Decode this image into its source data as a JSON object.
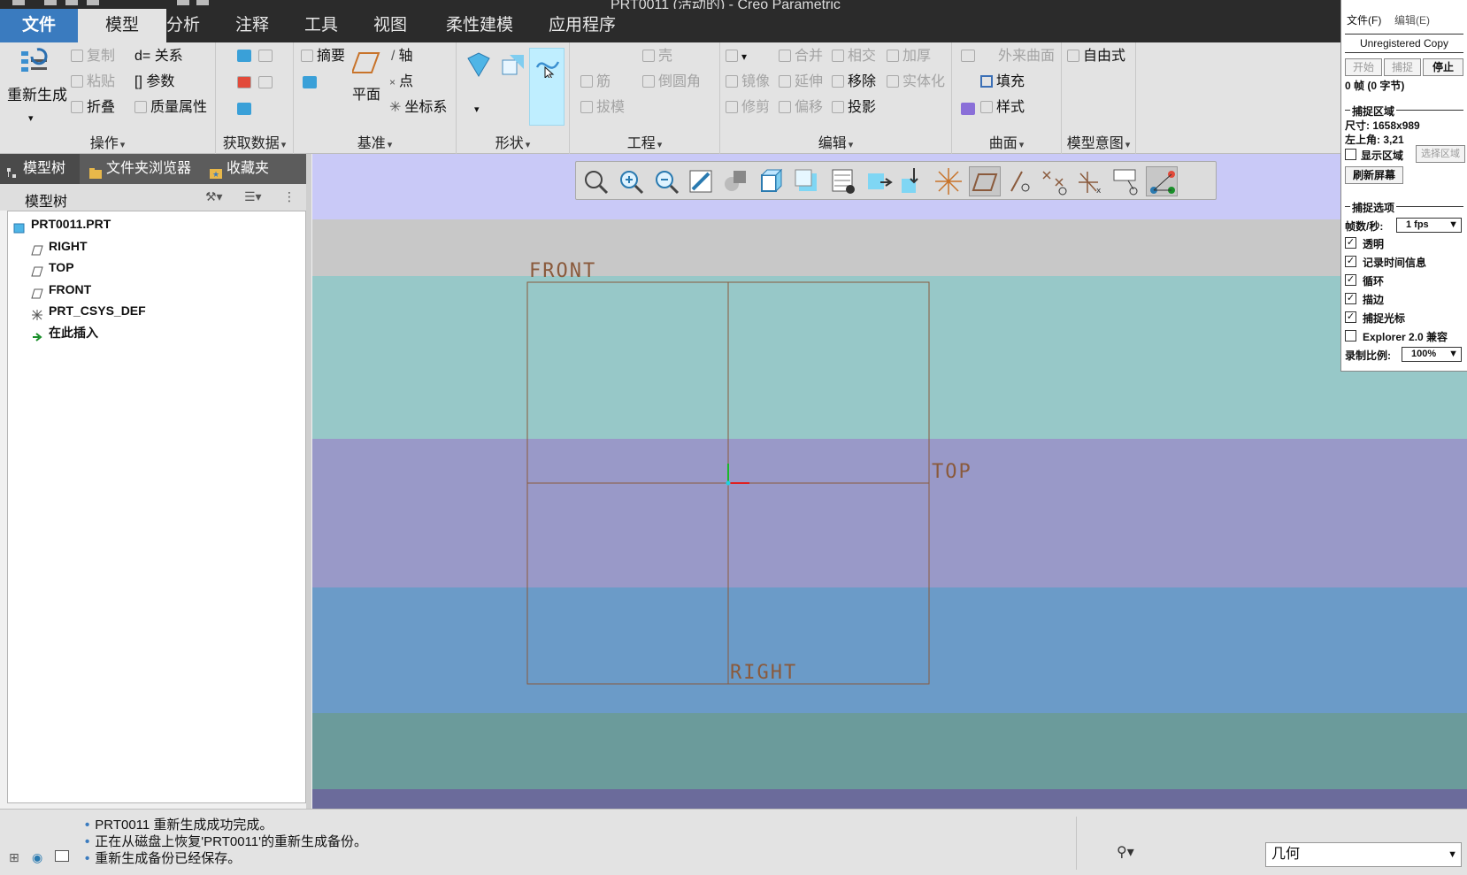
{
  "titlebar": {
    "title": "PRT0011 (活动的) - Creo Parametric"
  },
  "menu": {
    "file": "文件",
    "tabs": [
      "模型",
      "分析",
      "注释",
      "工具",
      "视图",
      "柔性建模",
      "应用程序"
    ]
  },
  "ribbon": {
    "ops": {
      "label": "操作",
      "regen": "重新生成",
      "copy": "复制",
      "paste": "粘贴",
      "relations": "d= 关系",
      "params": "[] 参数",
      "fold": "折叠",
      "mass": "质量属性"
    },
    "getdata": {
      "label": "获取数据"
    },
    "datum": {
      "label": "基准",
      "summary": "摘要",
      "plane": "平面",
      "axis": "轴",
      "point": "点",
      "csys": "坐标系"
    },
    "shape": {
      "label": "形状"
    },
    "eng": {
      "label": "工程",
      "shell": "壳",
      "rib": "筋",
      "round": "倒圆角",
      "draft": "拔模"
    },
    "edit": {
      "label": "编辑",
      "merge": "合并",
      "intersect": "相交",
      "thicken": "加厚",
      "mirror": "镜像",
      "extend": "延伸",
      "remove": "移除",
      "solidify": "实体化",
      "trim": "修剪",
      "offset": "偏移",
      "project": "投影"
    },
    "surface": {
      "label": "曲面",
      "boundary": "外来曲面",
      "fill": "填充",
      "style": "样式"
    },
    "intent": {
      "label": "模型意图",
      "freestyle": "自由式"
    }
  },
  "nav": {
    "tab_tree": "模型树",
    "tab_folder": "文件夹浏览器",
    "tab_fav": "收藏夹",
    "header": "模型树"
  },
  "tree": {
    "items": [
      "PRT0011.PRT",
      "RIGHT",
      "TOP",
      "FRONT",
      "PRT_CSYS_DEF",
      "在此插入"
    ]
  },
  "viewport": {
    "labels": {
      "front": "FRONT",
      "top": "TOP",
      "right": "RIGHT"
    },
    "colors": {
      "datum": "#8a5a3c",
      "accent_file": "#3a7bbf"
    }
  },
  "recorder": {
    "menu_file": "文件(F)",
    "menu_edit": "编辑(E)",
    "unregistered": "Unregistered Copy",
    "btn_start": "开始",
    "btn_capture": "捕捉",
    "btn_stop": "停止",
    "frames": "0 帧 (0 字节)",
    "sect_area": "捕捉区域",
    "size": "尺寸: 1658x989",
    "corner": "左上角: 3,21",
    "show_area": "显示区域",
    "btn_select_area": "选择区域",
    "btn_refresh": "刷新屏幕",
    "sect_options": "捕捉选项",
    "fps_label": "帧数/秒:",
    "fps_value": "1 fps",
    "opt_transparent": "透明",
    "opt_timeinfo": "记录时间信息",
    "opt_loop": "循环",
    "opt_border": "描边",
    "opt_cursor": "捕捉光标",
    "opt_explorer": "Explorer 2.0 兼容",
    "scale_label": "录制比例:",
    "scale_value": "100%"
  },
  "status": {
    "messages": [
      "PRT0011 重新生成成功完成。",
      "正在从磁盘上恢复'PRT0011'的重新生成备份。",
      "重新生成备份已经保存。"
    ],
    "filter": "几何"
  }
}
